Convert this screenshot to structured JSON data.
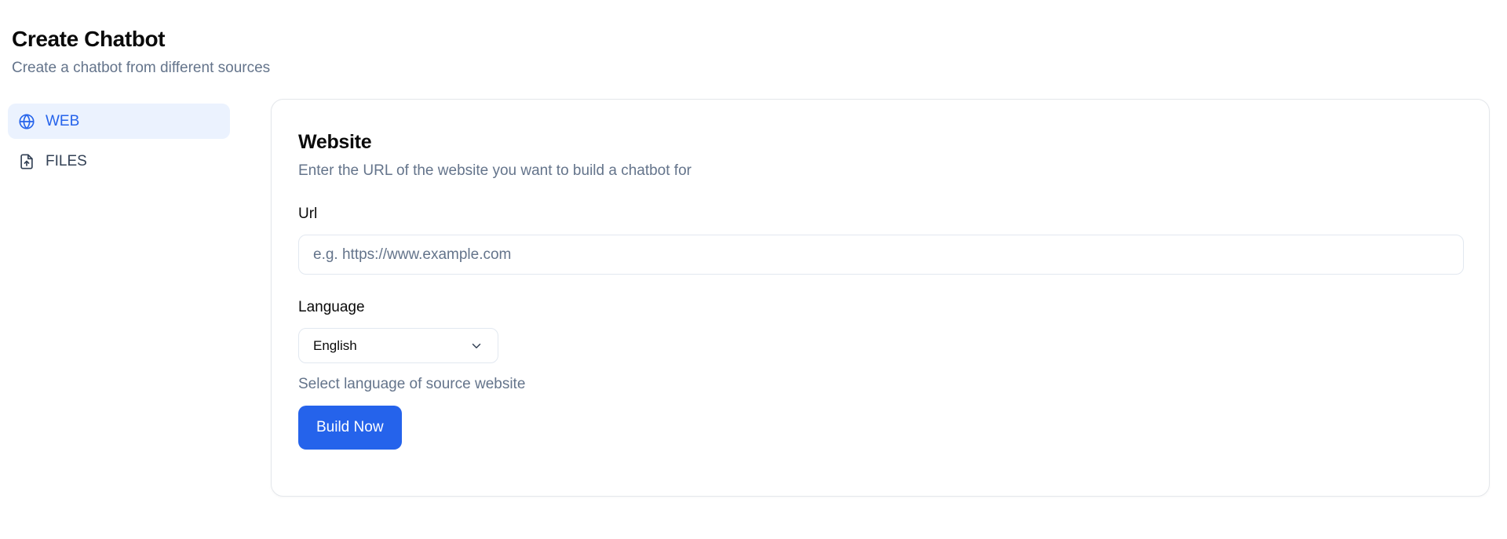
{
  "header": {
    "title": "Create Chatbot",
    "subtitle": "Create a chatbot from different sources"
  },
  "sidebar": {
    "items": [
      {
        "label": "WEB",
        "icon": "globe-icon",
        "active": true
      },
      {
        "label": "FILES",
        "icon": "file-upload-icon",
        "active": false
      }
    ]
  },
  "card": {
    "title": "Website",
    "description": "Enter the URL of the website you want to build a chatbot for",
    "url": {
      "label": "Url",
      "value": "",
      "placeholder": "e.g. https://www.example.com"
    },
    "language": {
      "label": "Language",
      "selected": "English",
      "help": "Select language of source website"
    },
    "submit_label": "Build Now"
  },
  "colors": {
    "accent": "#2563eb",
    "active_bg": "#ebf2fe",
    "muted_text": "#64748b",
    "border": "#e2e8f0"
  }
}
